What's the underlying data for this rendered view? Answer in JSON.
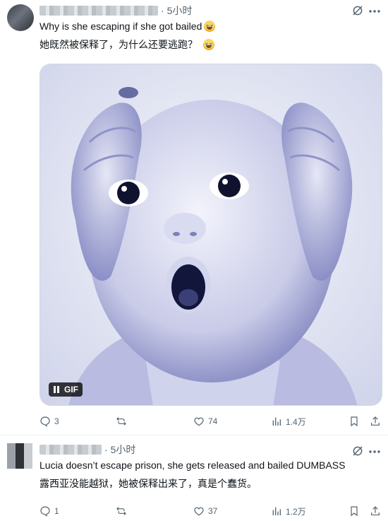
{
  "posts": [
    {
      "time_ago": "5小时",
      "line1": "Why is she escaping if she got bailed",
      "line2": "她既然被保释了，为什么还要逃跑？",
      "media": {
        "badge": "GIF"
      },
      "stats": {
        "replies": "3",
        "reposts": "",
        "likes": "74",
        "views": "1.4万"
      }
    },
    {
      "time_ago": "5小时",
      "line1": "Lucia doesn’t escape prison, she gets released and bailed DUMBASS",
      "line2": "露西亚没能越狱，她被保释出来了，真是个蠢货。",
      "stats": {
        "replies": "1",
        "reposts": "",
        "likes": "37",
        "views": "1.2万"
      }
    }
  ],
  "colors": {
    "text": "#0f1419",
    "secondary": "#536471",
    "border": "#cfd9de",
    "gif_badge": "#000000"
  },
  "icons": [
    "grok-icon",
    "more-icon",
    "reply-icon",
    "repost-icon",
    "like-icon",
    "views-icon",
    "bookmark-icon",
    "share-icon",
    "pause-icon",
    "crying-face-emoji"
  ]
}
